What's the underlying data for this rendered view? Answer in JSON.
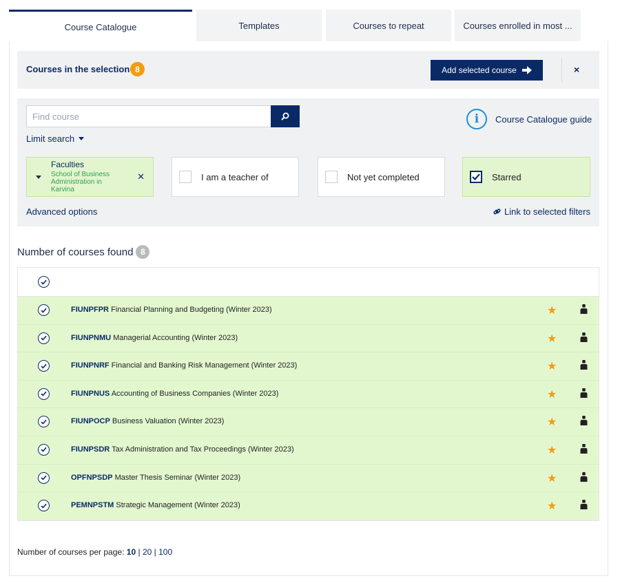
{
  "tabs": [
    {
      "label": "Course Catalogue",
      "active": true
    },
    {
      "label": "Templates",
      "active": false
    },
    {
      "label": "Courses to repeat",
      "active": false
    },
    {
      "label": "Courses enrolled in most ...",
      "active": false
    }
  ],
  "selection": {
    "title": "Courses in the selection",
    "count": "8",
    "add_button": "Add selected course",
    "close": "×"
  },
  "search": {
    "placeholder": "Find course",
    "value": "",
    "limit_search": "Limit search",
    "guide": "Course Catalogue guide"
  },
  "filters": {
    "faculties_title": "Faculties",
    "faculties_value": "School of Business Administration in Karvina",
    "teacher": {
      "label": "I am a teacher of",
      "checked": false
    },
    "not_completed": {
      "label": "Not yet completed",
      "checked": false
    },
    "starred": {
      "label": "Starred",
      "checked": true
    },
    "advanced": "Advanced options",
    "link": "Link to selected filters"
  },
  "results": {
    "title": "Number of courses found",
    "count": "8",
    "courses": [
      {
        "code": "FIUNPFPR",
        "name": "Financial Planning and Budgeting (Winter 2023)"
      },
      {
        "code": "FIUNPNMU",
        "name": "Managerial Accounting (Winter 2023)"
      },
      {
        "code": "FIUNPNRF",
        "name": "Financial and Banking Risk Management (Winter 2023)"
      },
      {
        "code": "FIUNPNUS",
        "name": "Accounting of Business Companies (Winter 2023)"
      },
      {
        "code": "FIUNPOCP",
        "name": "Business Valuation (Winter 2023)"
      },
      {
        "code": "FIUNPSDR",
        "name": "Tax Administration and Tax Proceedings (Winter 2023)"
      },
      {
        "code": "OPFNPSDP",
        "name": "Master Thesis Seminar (Winter 2023)"
      },
      {
        "code": "PEMNPSTM",
        "name": "Strategic Management (Winter 2023)"
      }
    ]
  },
  "pagination": {
    "label": "Number of courses per page:",
    "current": "10",
    "sep1": "|",
    "opt2": "20",
    "sep2": "|",
    "opt3": "100"
  },
  "colors": {
    "brand": "#0a2a66",
    "accent": "#f39c12",
    "row_bg": "#e3f7cf",
    "info": "#1e8fd6"
  }
}
